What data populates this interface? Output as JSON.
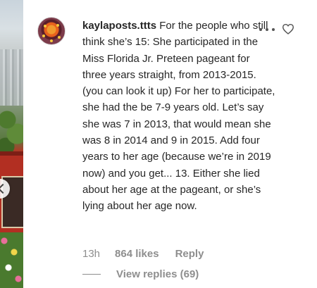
{
  "comment": {
    "username": "kaylaposts.ttts",
    "text": "For the people who still think she’s 15: She participated in the Miss Florida Jr. Preteen pageant for three years straight, from 2013-2015. (you can look it up) For her to participate, she had the be 7-9 years old. Let’s say she was 7 in 2013, that would mean she was 8 in 2014 and 9 in 2015. Add four years to her age (because we’re in 2019 now) and you get... 13. Either she lied about her age at the pageant, or she’s lying about her age now.",
    "time": "13h",
    "likes": "864 likes",
    "reply_label": "Reply",
    "view_replies_label": "View replies (69)"
  },
  "icons": {
    "more": "more-options-icon",
    "like": "heart-icon"
  },
  "colors": {
    "text": "#262626",
    "secondary": "#8e8e8e"
  }
}
